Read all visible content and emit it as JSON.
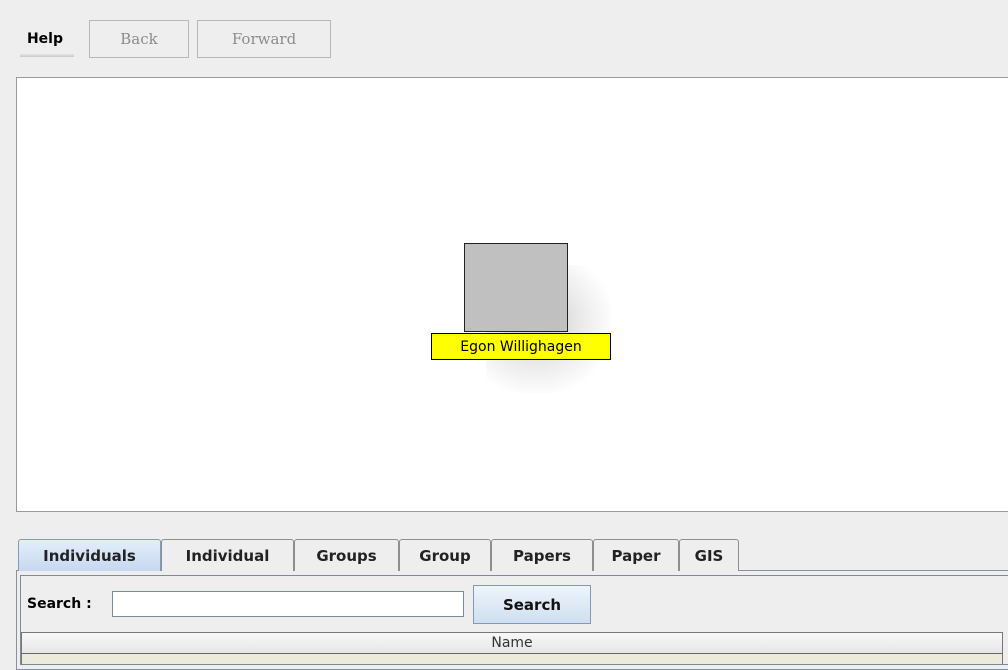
{
  "toolbar": {
    "help_label": "Help",
    "back_label": "Back",
    "forward_label": "Forward"
  },
  "graph": {
    "node_label": "Egon Willighagen",
    "node_color": "#c0c0c0",
    "label_bg": "#ffff00"
  },
  "tabs": [
    {
      "label": "Individuals",
      "active": true
    },
    {
      "label": "Individual",
      "active": false
    },
    {
      "label": "Groups",
      "active": false
    },
    {
      "label": "Group",
      "active": false
    },
    {
      "label": "Papers",
      "active": false
    },
    {
      "label": "Paper",
      "active": false
    },
    {
      "label": "GIS",
      "active": false
    }
  ],
  "search": {
    "label": "Search :",
    "value": "",
    "button_label": "Search"
  },
  "table": {
    "columns": [
      "Name"
    ]
  }
}
